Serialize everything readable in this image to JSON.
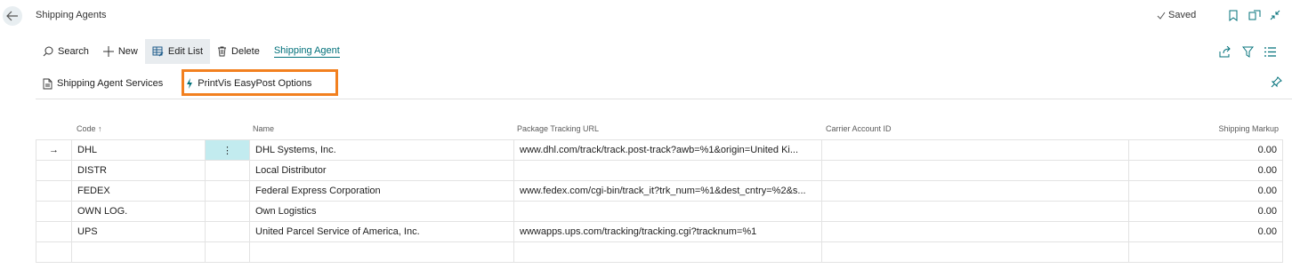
{
  "header": {
    "title": "Shipping Agents",
    "saved_label": "Saved"
  },
  "toolbar": {
    "search_label": "Search",
    "new_label": "New",
    "edit_list_label": "Edit List",
    "delete_label": "Delete",
    "shipping_agent_label": "Shipping Agent"
  },
  "subbar": {
    "services_label": "Shipping Agent Services",
    "easypost_label": "PrintVis EasyPost Options"
  },
  "table": {
    "columns": {
      "code": "Code ↑",
      "name": "Name",
      "url": "Package Tracking URL",
      "carrier": "Carrier Account ID",
      "markup": "Shipping Markup"
    },
    "rows": [
      {
        "code": "DHL",
        "name": "DHL Systems, Inc.",
        "url": "www.dhl.com/track/track.post-track?awb=%1&origin=United Ki...",
        "carrier": "",
        "markup": "0.00"
      },
      {
        "code": "DISTR",
        "name": "Local Distributor",
        "url": "",
        "carrier": "",
        "markup": "0.00"
      },
      {
        "code": "FEDEX",
        "name": "Federal Express Corporation",
        "url": "www.fedex.com/cgi-bin/track_it?trk_num=%1&dest_cntry=%2&s...",
        "carrier": "",
        "markup": "0.00"
      },
      {
        "code": "OWN LOG.",
        "name": "Own Logistics",
        "url": "",
        "carrier": "",
        "markup": "0.00"
      },
      {
        "code": "UPS",
        "name": "United Parcel Service of America, Inc.",
        "url": "wwwapps.ups.com/tracking/tracking.cgi?tracknum=%1",
        "carrier": "",
        "markup": "0.00"
      }
    ]
  },
  "colors": {
    "accent": "#00707a",
    "highlight": "#f2801f",
    "selected_cell": "#c2ebef"
  }
}
